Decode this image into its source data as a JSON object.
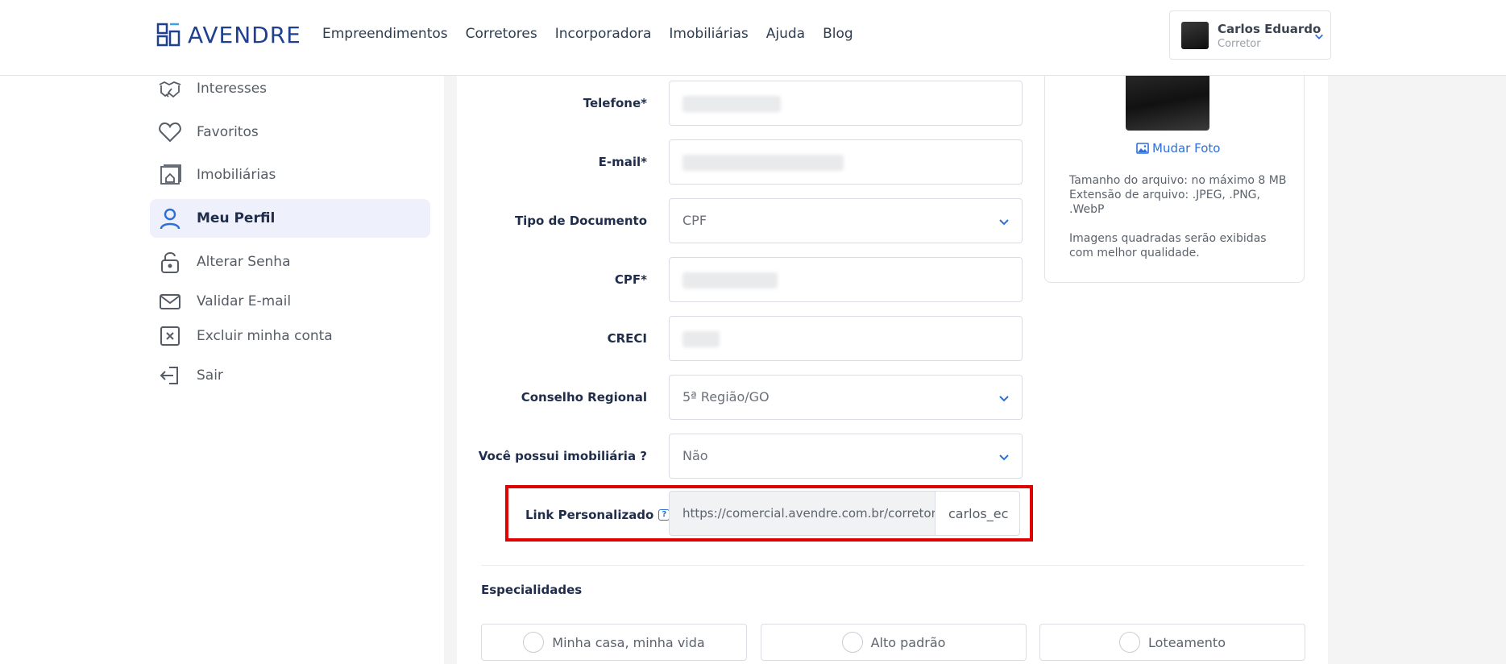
{
  "brand": {
    "name": "AVENDRE"
  },
  "nav": {
    "items": [
      "Empreendimentos",
      "Corretores",
      "Incorporadora",
      "Imobiliárias",
      "Ajuda",
      "Blog"
    ]
  },
  "user": {
    "name": "Carlos Eduardo",
    "role": "Corretor"
  },
  "sidebar": {
    "items": [
      {
        "label": "Interesses",
        "icon": "handshake-icon"
      },
      {
        "label": "Favoritos",
        "icon": "heart-icon"
      },
      {
        "label": "Imobiliárias",
        "icon": "building-icon"
      },
      {
        "label": "Meu Perfil",
        "icon": "user-icon",
        "active": true
      },
      {
        "label": "Alterar Senha",
        "icon": "lock-icon"
      },
      {
        "label": "Validar E-mail",
        "icon": "mail-icon"
      },
      {
        "label": "Excluir minha conta",
        "icon": "close-box-icon"
      },
      {
        "label": "Sair",
        "icon": "logout-icon"
      }
    ]
  },
  "form": {
    "telefone_label": "Telefone*",
    "email_label": "E-mail*",
    "tipo_documento_label": "Tipo de Documento",
    "tipo_documento_value": "CPF",
    "cpf_label": "CPF*",
    "creci_label": "CRECI",
    "conselho_label": "Conselho Regional",
    "conselho_value": "5ª Região/GO",
    "imobiliaria_label": "Você possui imobiliária ?",
    "imobiliaria_value": "Não",
    "link_label": "Link Personalizado",
    "link_prefix": "https://comercial.avendre.com.br/corretor/",
    "link_value": "carlos_ec"
  },
  "photo": {
    "change_label": "Mudar Foto",
    "info_size": "Tamanho do arquivo: no máximo 8 MB",
    "info_ext": "Extensão de arquivo: .JPEG, .PNG, .WebP",
    "info_quality": "Imagens quadradas serão exibidas com melhor qualidade."
  },
  "especialidades": {
    "title": "Especialidades",
    "options": [
      "Minha casa, minha vida",
      "Alto padrão",
      "Loteamento"
    ]
  },
  "colors": {
    "primary": "#2d6fd8",
    "highlight": "#e00000",
    "brand": "#1f3f8f"
  }
}
